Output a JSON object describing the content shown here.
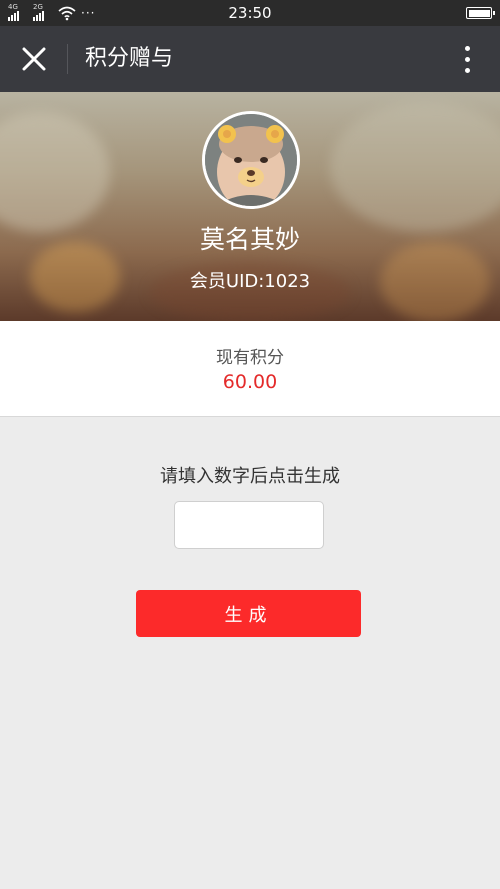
{
  "status_bar": {
    "network_1": "4G",
    "network_2": "2G",
    "more": "···",
    "time": "23:50"
  },
  "nav": {
    "title": "积分赠与"
  },
  "profile": {
    "name": "莫名其妙",
    "uid": "会员UID:1023"
  },
  "points": {
    "label": "现有积分",
    "value": "60.00"
  },
  "form": {
    "hint": "请填入数字后点击生成",
    "input_value": "",
    "input_placeholder": "",
    "button_label": "生成"
  },
  "colors": {
    "nav_background": "#393a3f",
    "accent_red": "#fc2a2a",
    "points_red": "#e42a2a",
    "page_background": "#ececec"
  },
  "icons": {
    "close": "close-icon",
    "more": "more-vertical-icon",
    "wifi": "wifi-icon",
    "battery": "battery-icon"
  }
}
